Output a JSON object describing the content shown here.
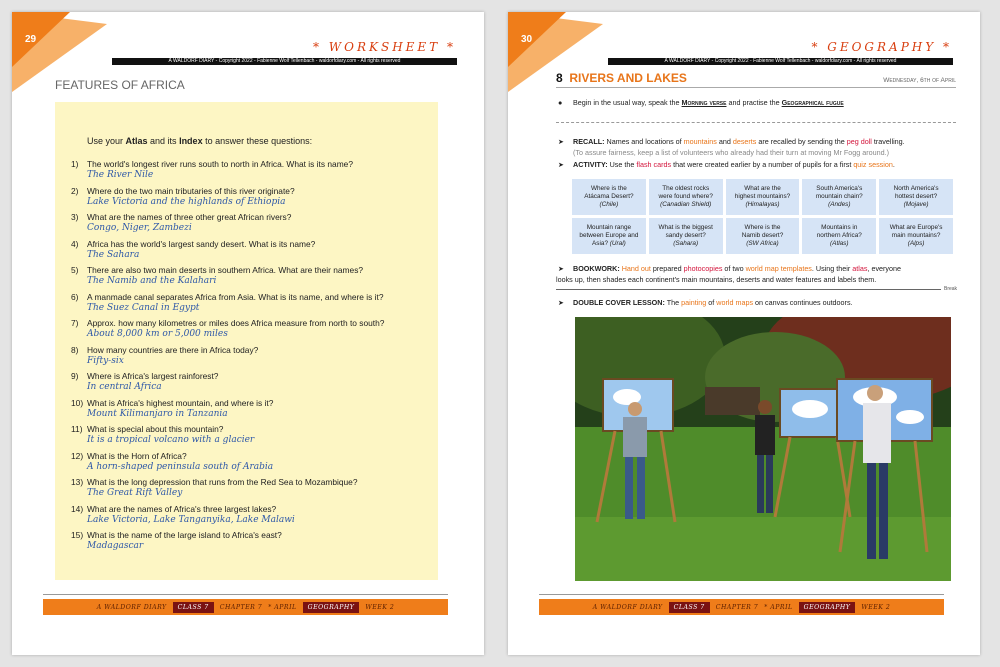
{
  "colors": {
    "accent": "#ef7d1a",
    "red": "#d3143b",
    "dark": "#7a1212",
    "answer": "#2e58a8",
    "panel": "#fdf6c4",
    "cell": "#d6e4f6"
  },
  "header": {
    "copyright": "A WALDORF DIARY - Copyright 2022 - Fabienne Wolf Tellenbach - waldorfdiary.com - All rights reserved"
  },
  "left": {
    "page_number": "29",
    "header_title": "* WORKSHEET *",
    "title": "FEATURES OF AFRICA",
    "intro": {
      "a": "Use your ",
      "b": "Atlas",
      "c": " and its ",
      "d": "Index",
      "e": " to answer these questions:"
    },
    "questions": [
      {
        "n": "1)",
        "q": "The world's longest river runs south to north in Africa. What is its name?",
        "a": "The River Nile"
      },
      {
        "n": "2)",
        "q": "Where do the two main tributaries of this river originate?",
        "a": "Lake Victoria and the highlands of Ethiopia"
      },
      {
        "n": "3)",
        "q": "What are the names of three other great African rivers?",
        "a": "Congo, Niger, Zambezi"
      },
      {
        "n": "4)",
        "q": "Africa has the world's largest sandy desert. What is its name?",
        "a": "The Sahara"
      },
      {
        "n": "5)",
        "q": "There are also two main deserts in southern Africa. What are their names?",
        "a": "The Namib and the Kalahari"
      },
      {
        "n": "6)",
        "q": "A manmade canal separates Africa from Asia. What is its name, and where is it?",
        "a": "The Suez Canal in Egypt"
      },
      {
        "n": "7)",
        "q": "Approx. how many kilometres or miles does Africa measure from north to south?",
        "a": "About 8,000 km or 5,000 miles"
      },
      {
        "n": "8)",
        "q": "How many countries are there in Africa today?",
        "a": "Fifty-six"
      },
      {
        "n": "9)",
        "q": "Where is Africa's largest rainforest?",
        "a": "In central Africa"
      },
      {
        "n": "10)",
        "q": "What is Africa's highest mountain, and where is it?",
        "a": "Mount Kilimanjaro in Tanzania"
      },
      {
        "n": "11)",
        "q": "What is special about this mountain?",
        "a": "It is a tropical volcano with a glacier"
      },
      {
        "n": "12)",
        "q": "What is the Horn of Africa?",
        "a": "A horn-shaped peninsula south of Arabia"
      },
      {
        "n": "13)",
        "q": "What is the long depression that runs from the Red Sea to Mozambique?",
        "a": "The Great Rift Valley"
      },
      {
        "n": "14)",
        "q": "What are the names of Africa's three largest lakes?",
        "a": "Lake Victoria, Lake Tanganyika, Lake Malawi"
      },
      {
        "n": "15)",
        "q": "What is the name of the large island to Africa's east?",
        "a": "Madagascar"
      }
    ]
  },
  "right": {
    "page_number": "30",
    "header_title": "* GEOGRAPHY *",
    "lesson_number": "8",
    "title": "RIVERS AND LAKES",
    "date": "Wednesday, 6th of April",
    "bullet": {
      "a": "Begin in the usual way, speak the ",
      "b": "Morning verse",
      "c": " and practise the ",
      "d": "Geographical fugue"
    },
    "recall": {
      "label": "RECALL:",
      "a": " Names and locations of ",
      "b": "mountains",
      "c": " and ",
      "d": "deserts",
      "e": " are recalled by sending the ",
      "f": "peg doll",
      "g": " travelling.",
      "note": "(To assure fairness, keep a list of volunteers who already had their turn at moving Mr Fogg around.)"
    },
    "activity": {
      "label": "ACTIVITY:",
      "a": " Use the ",
      "b": "flash cards",
      "c": " that were created earlier by a number of pupils for a first ",
      "d": "quiz session",
      "e": "."
    },
    "flash_cards": [
      {
        "q1": "Where is the",
        "q2": "Atácama Desert?",
        "a": "(Chile)"
      },
      {
        "q1": "The oldest rocks",
        "q2": "were found where?",
        "a": "(Canadian Shield)"
      },
      {
        "q1": "What are the",
        "q2": "highest mountains?",
        "a": "(Himalayas)"
      },
      {
        "q1": "South America's",
        "q2": "mountain chain?",
        "a": "(Andes)"
      },
      {
        "q1": "North America's",
        "q2": "hottest desert?",
        "a": "(Mojave)"
      },
      {
        "q1": "Mountain range",
        "q2": "between Europe and",
        "q3": "Asia?",
        "a": "(Ural)"
      },
      {
        "q1": "What is the biggest",
        "q2": "sandy desert?",
        "a": "(Sahara)"
      },
      {
        "q1": "Where is the",
        "q2": "Namib desert?",
        "a": "(SW Africa)"
      },
      {
        "q1": "Mountains in",
        "q2": "northern Africa?",
        "a": "(Atlas)"
      },
      {
        "q1": "What are Europe's",
        "q2": "main mountains?",
        "a": "(Alps)"
      }
    ],
    "bookwork": {
      "label": "BOOKWORK:",
      "a": " ",
      "b": "Hand out",
      "c": " prepared ",
      "d": "photocopies",
      "e": " of two ",
      "f": "world map templates",
      "g": ". Using their ",
      "h": "atlas",
      "i": ", everyone",
      "line2": "looks up, then shades each continent's main mountains, deserts and water features and labels them."
    },
    "break_label": "Break",
    "double": {
      "label": "DOUBLE COVER LESSON:",
      "a": " The ",
      "b": "painting",
      "c": " of ",
      "d": "world maps",
      "e": " on canvas continues outdoors."
    }
  },
  "footer": {
    "diary": "A WALDORF DIARY",
    "class": "CLASS 7",
    "chapter": "CHAPTER 7",
    "month": "*  APRIL",
    "subject": "GEOGRAPHY",
    "week": "WEEK 2"
  },
  "icons": {
    "arrow": "arrow-right-icon",
    "bullet": "bullet-icon"
  }
}
